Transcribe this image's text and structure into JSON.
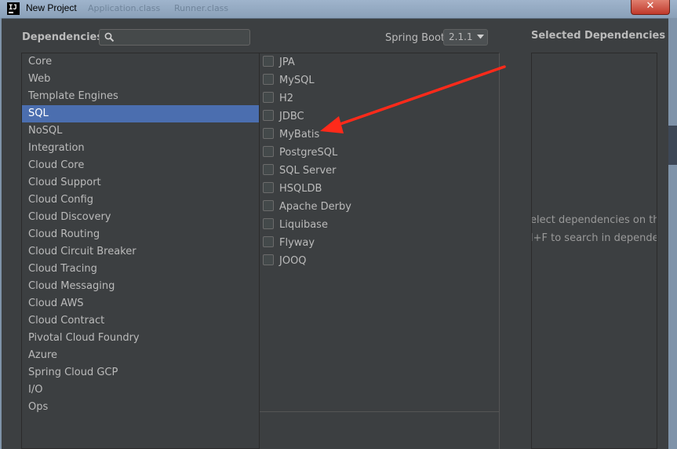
{
  "window": {
    "title": "New Project",
    "logo_text": "IJ",
    "close_glyph": "✕",
    "background_tabs": [
      "Application.class",
      "Runner.class"
    ]
  },
  "header": {
    "dependencies_label": "Dependencies",
    "search": {
      "value": "",
      "placeholder": ""
    },
    "spring_boot_label": "Spring Boot",
    "spring_boot_version": "2.1.1"
  },
  "categories": [
    "Core",
    "Web",
    "Template Engines",
    "SQL",
    "NoSQL",
    "Integration",
    "Cloud Core",
    "Cloud Support",
    "Cloud Config",
    "Cloud Discovery",
    "Cloud Routing",
    "Cloud Circuit Breaker",
    "Cloud Tracing",
    "Cloud Messaging",
    "Cloud AWS",
    "Cloud Contract",
    "Pivotal Cloud Foundry",
    "Azure",
    "Spring Cloud GCP",
    "I/O",
    "Ops"
  ],
  "selected_category": "SQL",
  "dependencies": [
    "JPA",
    "MySQL",
    "H2",
    "JDBC",
    "MyBatis",
    "PostgreSQL",
    "SQL Server",
    "HSQLDB",
    "Apache Derby",
    "Liquibase",
    "Flyway",
    "JOOQ"
  ],
  "selected_panel": {
    "label": "Selected Dependencies",
    "hint_line1": "elect dependencies on the le",
    "hint_line2": "l+F to search in dependenc"
  },
  "annotation": {
    "arrow_color": "#ff2a1a"
  },
  "colors": {
    "background": "#3c3f41",
    "selection": "#4b6eaf",
    "text": "#bbbbbb"
  }
}
